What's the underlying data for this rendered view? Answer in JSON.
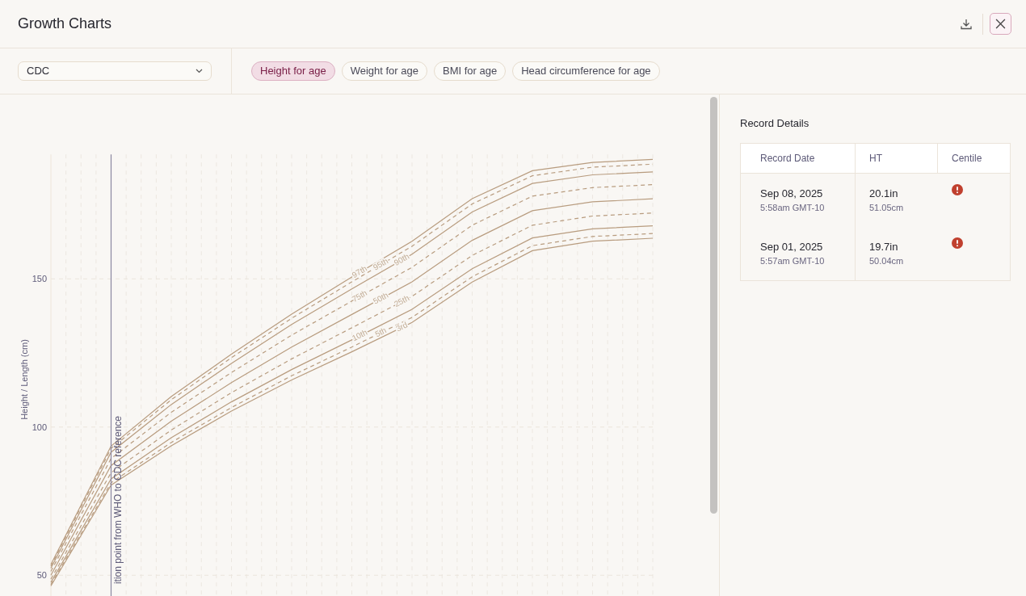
{
  "window": {
    "title": "Growth Charts"
  },
  "reference_select": {
    "value": "CDC"
  },
  "tabs": [
    {
      "label": "Height for age",
      "selected": true
    },
    {
      "label": "Weight for age",
      "selected": false
    },
    {
      "label": "BMI for age",
      "selected": false
    },
    {
      "label": "Head circumference for age",
      "selected": false
    }
  ],
  "chart": {
    "transition_label": "ition point from WHO to CDC reference",
    "chart_data": {
      "type": "line",
      "ylabel": "Height / Length (cm)",
      "categories": [
        null,
        null,
        null,
        null,
        null,
        null,
        null,
        null,
        null,
        null,
        null
      ],
      "ylim": [
        43,
        192
      ],
      "grid": true,
      "yticks": [
        50,
        100,
        150
      ],
      "series": [
        {
          "name": "97th",
          "color": "#b89c7f",
          "line_style": "solid",
          "values": [
            53.6,
            93.6,
            110.3,
            124.6,
            138.1,
            150.6,
            162.7,
            177.1,
            186.5,
            189.3,
            190.3
          ]
        },
        {
          "name": "95th",
          "color": "#b89c7f",
          "line_style": "dashed",
          "values": [
            53.1,
            92.8,
            109.2,
            123.4,
            136.7,
            149.0,
            161.0,
            175.3,
            184.8,
            187.7,
            188.7
          ]
        },
        {
          "name": "90th",
          "color": "#b89c7f",
          "line_style": "solid",
          "values": [
            52.4,
            91.5,
            107.6,
            121.5,
            134.6,
            146.6,
            158.3,
            172.6,
            182.2,
            185.1,
            186.1
          ]
        },
        {
          "name": "75th",
          "color": "#b89c7f",
          "line_style": "dashed",
          "values": [
            51.3,
            89.4,
            105.0,
            118.4,
            131.0,
            142.5,
            153.9,
            168.1,
            177.9,
            180.8,
            181.8
          ]
        },
        {
          "name": "50th",
          "color": "#b89c7f",
          "line_style": "solid",
          "values": [
            50,
            87,
            102,
            115,
            127,
            138,
            149,
            163,
            173,
            176,
            177
          ]
        },
        {
          "name": "25th",
          "color": "#b89c7f",
          "line_style": "dashed",
          "values": [
            48.7,
            84.6,
            99.0,
            111.6,
            123.0,
            133.5,
            144.1,
            157.9,
            168.1,
            171.2,
            172.2
          ]
        },
        {
          "name": "10th",
          "color": "#b89c7f",
          "line_style": "solid",
          "values": [
            47.6,
            82.5,
            96.4,
            108.5,
            119.4,
            129.4,
            139.7,
            153.4,
            163.8,
            166.9,
            167.9
          ]
        },
        {
          "name": "5th",
          "color": "#b89c7f",
          "line_style": "dashed",
          "values": [
            46.9,
            81.2,
            94.8,
            106.6,
            117.3,
            127.0,
            137.0,
            150.7,
            161.2,
            164.3,
            165.3
          ]
        },
        {
          "name": "3rd",
          "color": "#b89c7f",
          "line_style": "solid",
          "values": [
            46.4,
            80.4,
            93.7,
            105.4,
            115.9,
            125.4,
            135.3,
            148.9,
            159.5,
            162.7,
            163.7
          ]
        }
      ]
    }
  },
  "record_details": {
    "title": "Record Details",
    "columns": [
      "Record Date",
      "HT",
      "Centile"
    ],
    "rows": [
      {
        "date": "Sep 08, 2025",
        "time": "5:58am GMT-10",
        "ht_in": "20.1in",
        "ht_cm": "51.05cm",
        "centile_warning": true
      },
      {
        "date": "Sep 01, 2025",
        "time": "5:57am GMT-10",
        "ht_in": "19.7in",
        "ht_cm": "50.04cm",
        "centile_warning": true
      }
    ]
  }
}
